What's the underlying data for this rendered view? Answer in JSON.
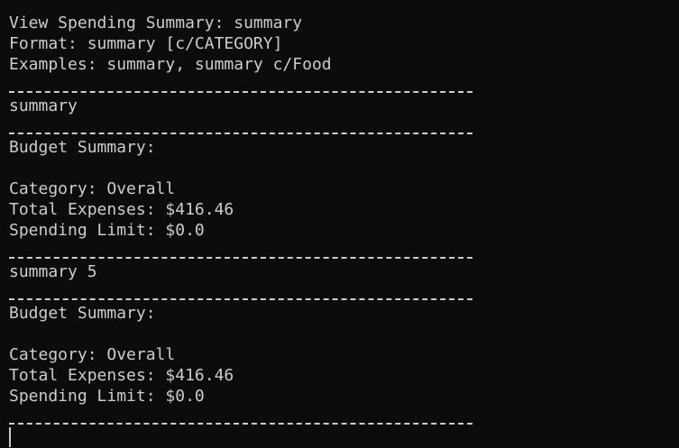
{
  "terminal": {
    "lines": [
      "View Spending Summary: summary",
      "Format: summary [c/CATEGORY]",
      "Examples: summary, summary c/Food",
      "---",
      "summary",
      "---",
      "Budget Summary:",
      "",
      "Category: Overall",
      "Total Expenses: $416.46",
      "Spending Limit: $0.0",
      "---",
      "summary 5",
      "---",
      "Budget Summary:",
      "",
      "Category: Overall",
      "Total Expenses: $416.46",
      "Spending Limit: $0.0",
      "---"
    ]
  },
  "colors": {
    "background": "#0c0c0c",
    "text": "#cccccc"
  }
}
